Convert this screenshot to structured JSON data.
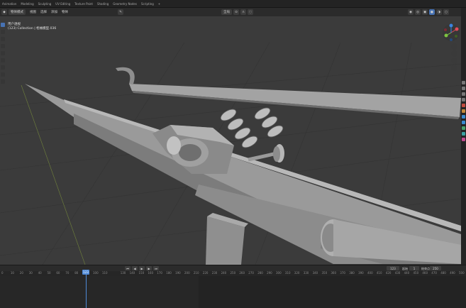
{
  "workspace_tabs": [
    "Animation",
    "Modeling",
    "Sculpting",
    "UV Editing",
    "Texture Paint",
    "Shading",
    "Geometry Nodes",
    "Scripting",
    "+"
  ],
  "header": {
    "mode": "物体模式",
    "menus": [
      "视图",
      "选择",
      "添加",
      "物体"
    ],
    "transform": "全局",
    "snap": "",
    "overlay_label": "选项"
  },
  "viewport_info": {
    "line1": "用户透视",
    "line2": "(123) Collection | 枪械模型.036"
  },
  "timeline": {
    "current_frame": "123",
    "start_label": "起始",
    "start": "1",
    "end_label": "结束点",
    "end": "250",
    "ticks": [
      "0",
      "10",
      "20",
      "30",
      "40",
      "50",
      "60",
      "70",
      "80",
      "90",
      "100",
      "110",
      "123",
      "130",
      "140",
      "150",
      "160",
      "170",
      "180",
      "190",
      "200",
      "210",
      "220",
      "230",
      "240",
      "250",
      "260",
      "270",
      "280",
      "290",
      "300",
      "310",
      "320",
      "330",
      "340",
      "350",
      "360",
      "370",
      "380",
      "390",
      "400",
      "410",
      "420",
      "430",
      "440",
      "450",
      "460",
      "470",
      "480",
      "490",
      "500"
    ]
  },
  "colors": {
    "accent": "#4772b3",
    "playhead": "#4f8ad8",
    "gizmo_x": "#e24b5a",
    "gizmo_y": "#7ec540",
    "gizmo_z": "#3a84e0"
  },
  "icons": [
    "blender-icon",
    "object-mode-icon",
    "cursor-icon",
    "move-icon",
    "rotate-icon",
    "scale-icon",
    "transform-icon",
    "annotate-icon",
    "measure-icon",
    "add-cube-icon",
    "zoom-icon",
    "hand-icon",
    "camera-icon",
    "grid-icon",
    "play-icon"
  ]
}
